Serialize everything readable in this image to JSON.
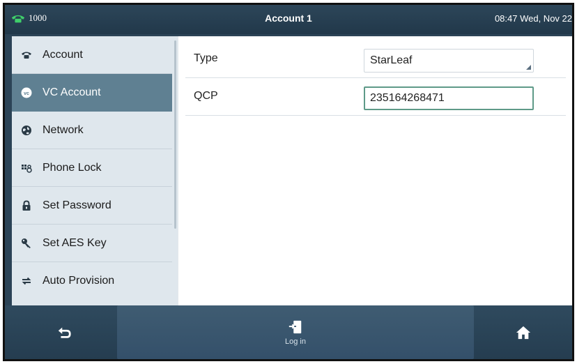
{
  "status_bar": {
    "line": "1000",
    "title": "Account 1",
    "datetime": "08:47 Wed, Nov 22"
  },
  "sidebar": {
    "items": [
      {
        "label": "Account",
        "icon": "phone-icon",
        "active": false
      },
      {
        "label": "VC Account",
        "icon": "vc-icon",
        "active": true
      },
      {
        "label": "Network",
        "icon": "globe-icon",
        "active": false
      },
      {
        "label": "Phone Lock",
        "icon": "keypad-icon",
        "active": false
      },
      {
        "label": "Set Password",
        "icon": "lock-icon",
        "active": false
      },
      {
        "label": "Set AES Key",
        "icon": "key-icon",
        "active": false
      },
      {
        "label": "Auto Provision",
        "icon": "sync-icon",
        "active": false
      }
    ]
  },
  "form": {
    "type": {
      "label": "Type",
      "value": "StarLeaf"
    },
    "qcp": {
      "label": "QCP",
      "value": "235164268471"
    }
  },
  "softkeys": {
    "back": "back-icon",
    "login": "Log in",
    "home": "home-icon"
  },
  "colors": {
    "active_item": "#5f8092",
    "focus_border": "#5e9a88",
    "status_bar": "#2b4356"
  }
}
